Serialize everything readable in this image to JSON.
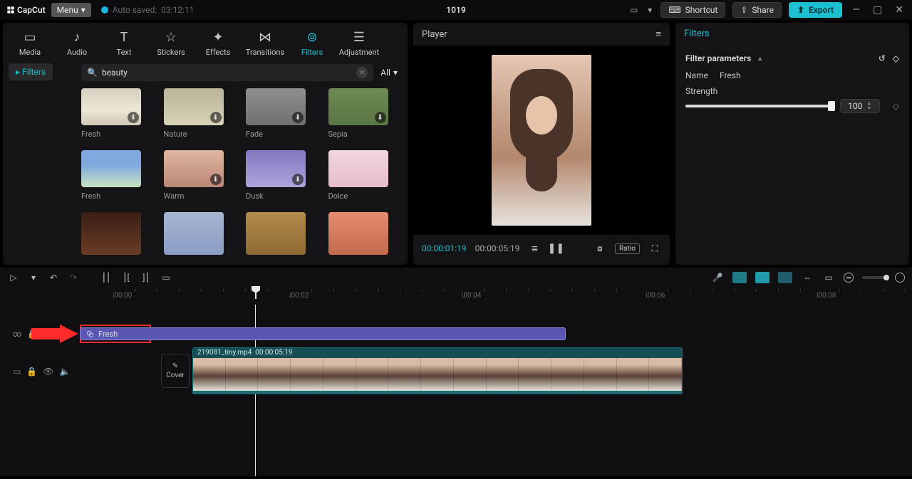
{
  "titlebar": {
    "brand": "CapCut",
    "menu": "Menu",
    "autosaved_prefix": "Auto saved:",
    "autosaved_time": "03:12:11",
    "project_title": "1019",
    "shortcut": "Shortcut",
    "share": "Share",
    "export": "Export"
  },
  "nav": {
    "items": [
      {
        "label": "Media"
      },
      {
        "label": "Audio"
      },
      {
        "label": "Text"
      },
      {
        "label": "Stickers"
      },
      {
        "label": "Effects"
      },
      {
        "label": "Transitions"
      },
      {
        "label": "Filters"
      },
      {
        "label": "Adjustment"
      }
    ],
    "active_index": 6
  },
  "left": {
    "side_chip": "Filters",
    "search_value": "beauty",
    "all_label": "All",
    "thumbs": [
      {
        "label": "Fresh",
        "cls": "t-fresh1",
        "dl": true
      },
      {
        "label": "Nature",
        "cls": "t-nature",
        "dl": true
      },
      {
        "label": "Fade",
        "cls": "t-fade",
        "dl": true
      },
      {
        "label": "Sepia",
        "cls": "t-sepia",
        "dl": true
      },
      {
        "label": "Fresh",
        "cls": "t-fresh2",
        "dl": false
      },
      {
        "label": "Warm",
        "cls": "t-warm",
        "dl": true
      },
      {
        "label": "Dusk",
        "cls": "t-dusk",
        "dl": true
      },
      {
        "label": "Dolce",
        "cls": "t-dolce",
        "dl": false
      },
      {
        "label": "",
        "cls": "t-r3a",
        "dl": false
      },
      {
        "label": "",
        "cls": "t-r3b",
        "dl": false
      },
      {
        "label": "",
        "cls": "t-r3c",
        "dl": false
      },
      {
        "label": "",
        "cls": "t-r3d",
        "dl": false
      }
    ]
  },
  "player": {
    "title": "Player",
    "current_time": "00:00:01:19",
    "duration": "00:00:05:19",
    "ratio_label": "Ratio"
  },
  "right": {
    "title": "Filters",
    "section": "Filter parameters",
    "name_label": "Name",
    "name_value": "Fresh",
    "strength_label": "Strength",
    "strength_value": "100",
    "strength_pct": 100
  },
  "timeline": {
    "ticks": [
      "00:00",
      "00:02",
      "00:04",
      "00:06",
      "00:08"
    ],
    "filter_clip_label": "Fresh",
    "video_clip_name": "219081_tiny.mp4",
    "video_clip_dur": "00:00:05:19",
    "cover_label": "Cover"
  }
}
